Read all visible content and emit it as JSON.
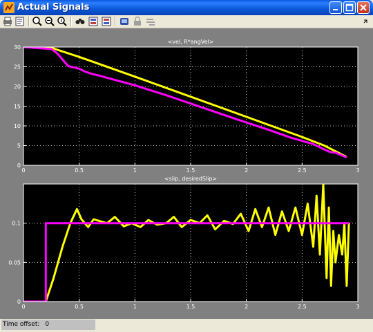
{
  "window": {
    "title": "Actual Signals"
  },
  "toolbar": {
    "tools": [
      "print-icon",
      "parameters-icon",
      "zoom-icon",
      "zoom-x-icon",
      "zoom-y-icon",
      "autoscale-icon",
      "save-axes-icon",
      "restore-axes-icon",
      "floating-scope-icon",
      "lock-icon",
      "signal-selection-icon"
    ]
  },
  "status": {
    "label": "Time offset:",
    "value": "0"
  },
  "colors": {
    "yellow": "#ffff00",
    "magenta": "#ff00ff",
    "axes_bg": "#000000",
    "frame_bg": "#808080"
  },
  "chart_data": [
    {
      "type": "line",
      "title": "<vel, R*angVel>",
      "xlim": [
        0,
        3
      ],
      "ylim": [
        0,
        30
      ],
      "xticks": [
        0,
        0.5,
        1,
        1.5,
        2,
        2.5,
        3
      ],
      "yticks": [
        0,
        5,
        10,
        15,
        20,
        25,
        30
      ],
      "grid": true,
      "series": [
        {
          "color": "#ffff00",
          "x": [
            0,
            0.25,
            0.5,
            1.0,
            1.5,
            2.0,
            2.5,
            2.7,
            2.9
          ],
          "y": [
            30,
            29.8,
            27.5,
            22.5,
            17.4,
            12.3,
            7.2,
            5.0,
            2.1
          ]
        },
        {
          "color": "#ff00ff",
          "x": [
            0,
            0.25,
            0.3,
            0.4,
            0.5,
            0.55,
            0.6,
            0.7,
            0.8,
            1.0,
            1.3,
            1.6,
            1.9,
            2.2,
            2.4,
            2.5,
            2.6,
            2.7,
            2.75,
            2.8,
            2.9
          ],
          "y": [
            30,
            29.5,
            28.5,
            25.2,
            24.5,
            23.8,
            23.3,
            22.6,
            21.8,
            20.3,
            17.6,
            14.7,
            11.8,
            9.0,
            7.0,
            6.2,
            5.4,
            4.0,
            3.4,
            3.2,
            2.0
          ]
        }
      ]
    },
    {
      "type": "line",
      "title": "<slip, desiredSlip>",
      "xlim": [
        0,
        3
      ],
      "ylim": [
        0,
        0.15
      ],
      "xticks": [
        0,
        0.5,
        1,
        1.5,
        2,
        2.5,
        3
      ],
      "yticks": [
        0,
        0.05,
        0.1
      ],
      "grid": true,
      "series": [
        {
          "color": "#ffff00",
          "x": [
            0.2,
            0.27,
            0.35,
            0.42,
            0.48,
            0.52,
            0.58,
            0.63,
            0.7,
            0.75,
            0.82,
            0.9,
            0.97,
            1.05,
            1.12,
            1.2,
            1.28,
            1.35,
            1.42,
            1.5,
            1.58,
            1.65,
            1.72,
            1.8,
            1.88,
            1.95,
            2.02,
            2.08,
            2.14,
            2.2,
            2.26,
            2.32,
            2.38,
            2.44,
            2.5,
            2.55,
            2.6,
            2.63,
            2.66,
            2.69,
            2.72,
            2.74,
            2.76,
            2.78,
            2.8,
            2.83,
            2.86,
            2.88,
            2.9,
            2.92
          ],
          "y": [
            0.0,
            0.03,
            0.07,
            0.1,
            0.118,
            0.105,
            0.095,
            0.105,
            0.102,
            0.1,
            0.108,
            0.096,
            0.1,
            0.095,
            0.104,
            0.098,
            0.1,
            0.108,
            0.095,
            0.104,
            0.1,
            0.11,
            0.092,
            0.103,
            0.099,
            0.112,
            0.09,
            0.118,
            0.095,
            0.12,
            0.085,
            0.115,
            0.09,
            0.12,
            0.085,
            0.125,
            0.07,
            0.135,
            0.06,
            0.15,
            0.03,
            0.12,
            0.02,
            0.09,
            0.05,
            0.085,
            0.06,
            0.1,
            0.02,
            0.1
          ]
        },
        {
          "color": "#ff00ff",
          "x": [
            0,
            0.2,
            0.2,
            2.92
          ],
          "y": [
            0,
            0,
            0.1,
            0.1
          ]
        }
      ]
    }
  ]
}
